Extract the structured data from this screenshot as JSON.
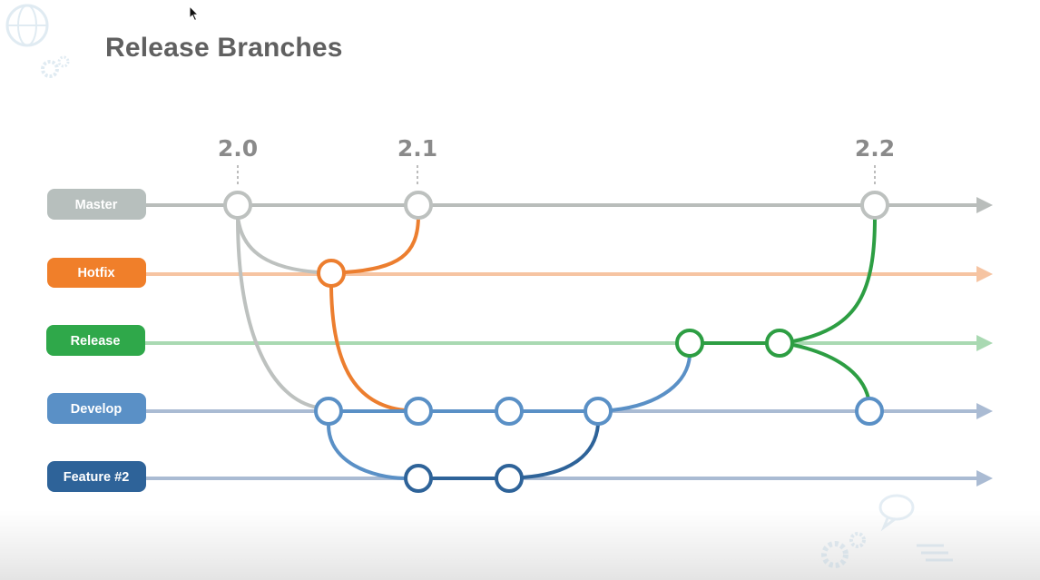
{
  "slide": {
    "title": "Release Branches"
  },
  "versions": [
    "2.0",
    "2.1",
    "2.2"
  ],
  "branches": [
    {
      "id": "master",
      "label": "Master",
      "color": "#b7bfbd",
      "line": "#b9bdbb"
    },
    {
      "id": "hotfix",
      "label": "Hotfix",
      "color": "#f07f2a",
      "line": "#f6c4a2"
    },
    {
      "id": "release",
      "label": "Release",
      "color": "#2fa84a",
      "line": "#a9d9b2"
    },
    {
      "id": "develop",
      "label": "Develop",
      "color": "#5a90c6",
      "line": "#aabbd3"
    },
    {
      "id": "feature2",
      "label": "Feature #2",
      "color": "#2e6399",
      "line": "#aabbd3"
    }
  ],
  "connector_colors": {
    "master": "#bdc1bf",
    "hotfix": "#ec7e2f",
    "release": "#2d9e43",
    "develop": "#5a90c6",
    "feature": "#2e6399"
  },
  "icons": [
    "globe-icon",
    "gears-icon",
    "chat-bubble-icon",
    "gears-icon",
    "mouse-pointer-icon"
  ]
}
